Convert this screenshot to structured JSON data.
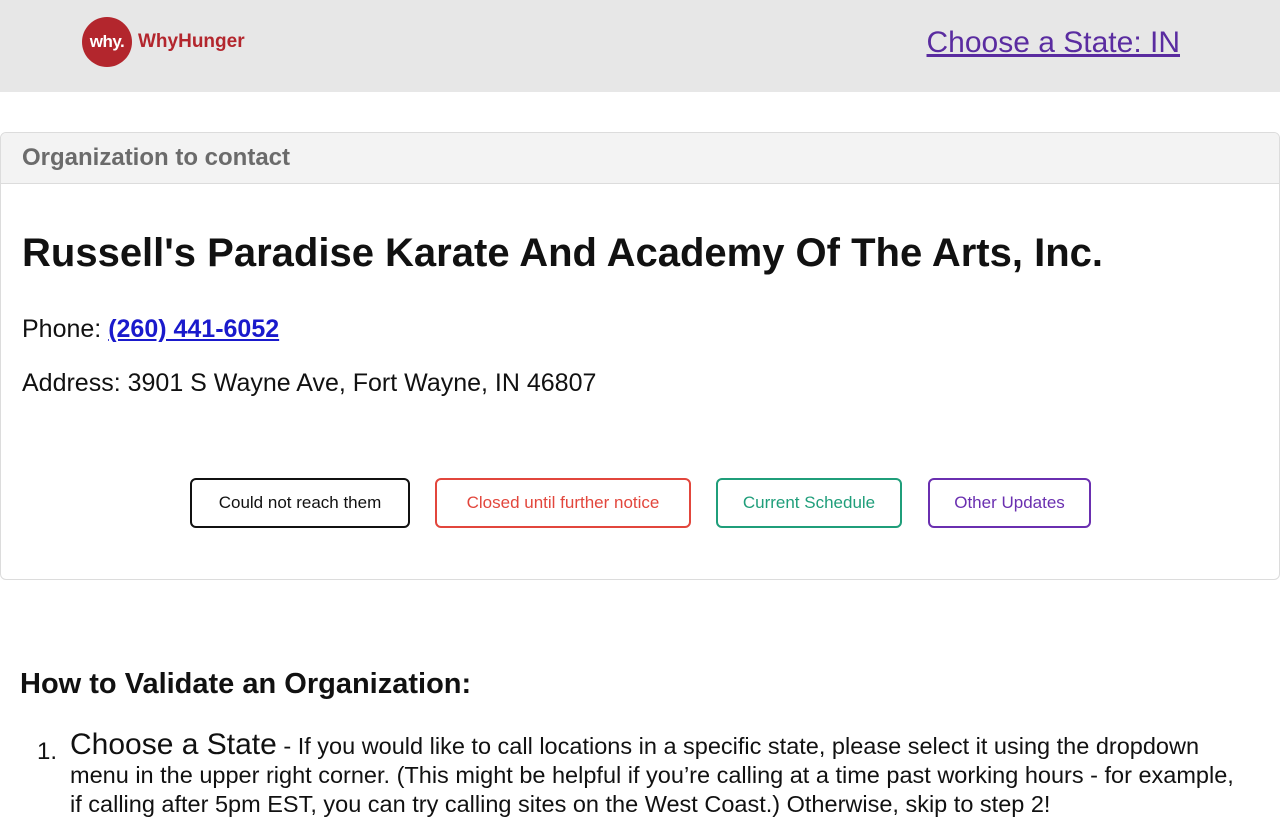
{
  "header": {
    "logo_mark": "why.",
    "logo_text": "WhyHunger",
    "state_link": "Choose a State: IN"
  },
  "card": {
    "header_title": "Organization to contact",
    "org_name": "Russell's Paradise Karate And Academy Of The Arts, Inc.",
    "phone_label": "Phone: ",
    "phone_value": "(260) 441-6052",
    "address_label": "Address: ",
    "address_value": "3901 S Wayne Ave, Fort Wayne, IN 46807",
    "buttons": {
      "could_not_reach": "Could not reach them",
      "closed": "Closed until further notice",
      "current_schedule": "Current Schedule",
      "other_updates": "Other Updates"
    }
  },
  "howto": {
    "title": "How to Validate an Organization:",
    "steps": [
      {
        "number": "1.",
        "title": "Choose a State",
        "text": " - If you would like to call locations in a specific state, please select it using the dropdown menu in the upper right corner. (This might be helpful if you’re calling at a time past working hours - for example, if calling after 5pm EST, you can try calling sites on the West Coast.) Otherwise, skip to step 2!"
      }
    ]
  },
  "colors": {
    "brand_red": "#b3262d",
    "header_bg": "#e7e7e7",
    "link_purple": "#5a2ca0",
    "phone_blue": "#1a1acc",
    "btn_black": "#111111",
    "btn_red": "#e2463c",
    "btn_green": "#1f9e7a",
    "btn_purple": "#6a2fb0"
  }
}
